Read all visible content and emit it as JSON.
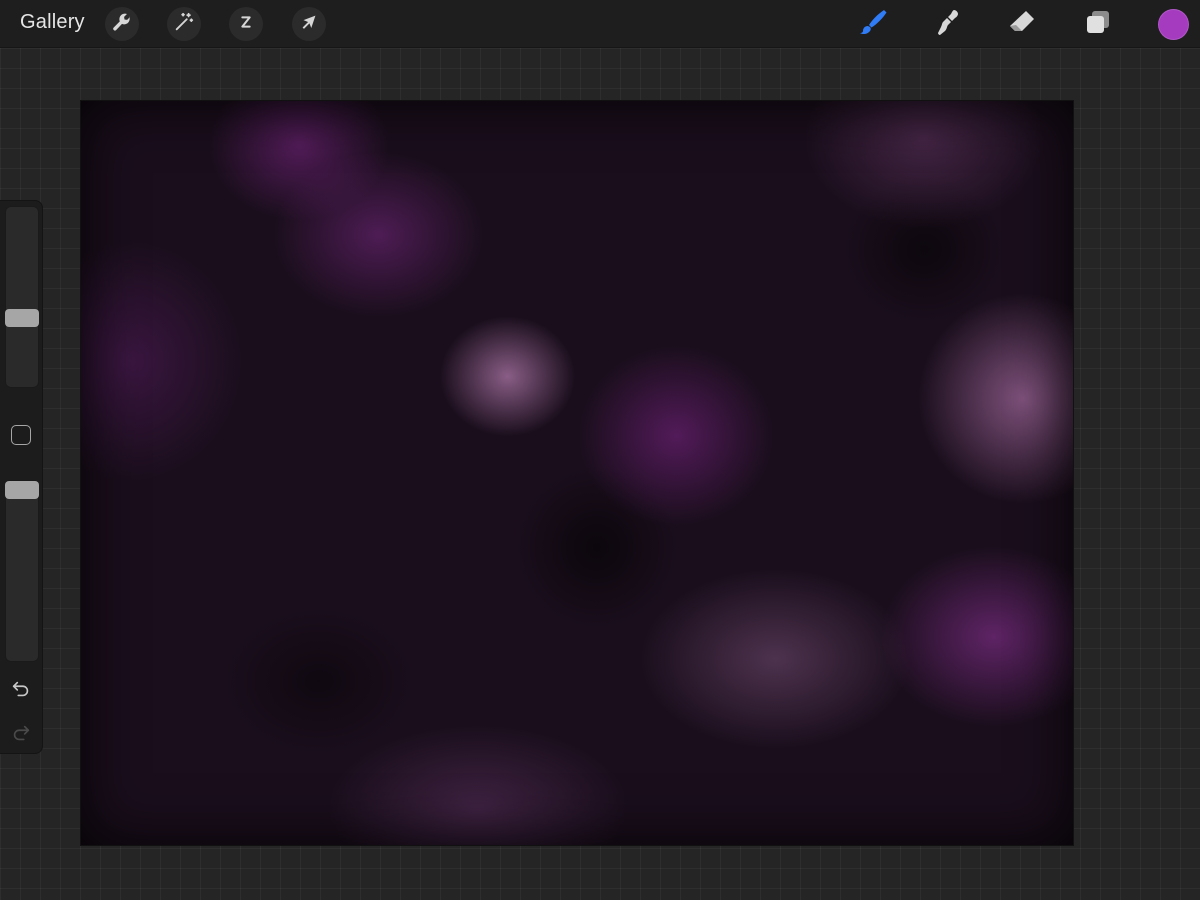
{
  "toolbar": {
    "gallery_label": "Gallery",
    "left_tools": [
      {
        "name": "actions",
        "icon": "wrench-icon"
      },
      {
        "name": "adjustments",
        "icon": "magic-wand-icon"
      },
      {
        "name": "selection",
        "icon": "selection-s-icon"
      },
      {
        "name": "transform",
        "icon": "arrow-cursor-icon"
      }
    ],
    "right_tools": [
      {
        "name": "brush",
        "icon": "brush-icon",
        "active": true,
        "color": "#2f7cf6"
      },
      {
        "name": "smudge",
        "icon": "smudge-finger-icon",
        "active": false
      },
      {
        "name": "eraser",
        "icon": "eraser-icon",
        "active": false
      },
      {
        "name": "layers",
        "icon": "layers-icon",
        "active": false
      }
    ],
    "current_color": "#a53cc0"
  },
  "sidebar": {
    "brush_size": 0.4,
    "opacity": 1.0,
    "modify_icon": "square-icon",
    "undo_icon": "undo-arrow-icon",
    "redo_icon": "redo-arrow-icon",
    "redo_enabled": false
  }
}
